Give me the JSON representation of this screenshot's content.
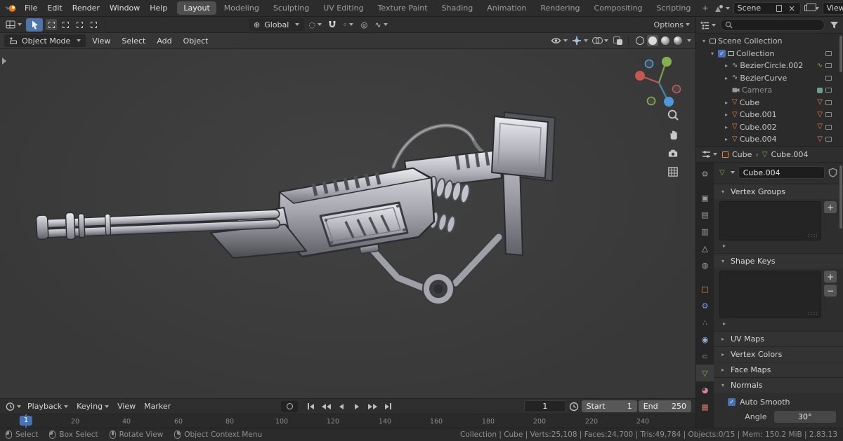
{
  "colors": {
    "accent_blue": "#4772b3",
    "mesh_orange": "#e8883d",
    "data_green": "#6fb747",
    "header_bg": "#2e2e2e",
    "viewport_bg": "#3d3d3d"
  },
  "topbar": {
    "menus": [
      "File",
      "Edit",
      "Render",
      "Window",
      "Help"
    ],
    "workspaces": [
      "Layout",
      "Modeling",
      "Sculpting",
      "UV Editing",
      "Texture Paint",
      "Shading",
      "Animation",
      "Rendering",
      "Compositing",
      "Scripting"
    ],
    "active_workspace": "Layout",
    "add_workspace_label": "+",
    "scene_label": "Scene",
    "view_layer_label": "View Layer"
  },
  "tool_header": {
    "orientation": "Global",
    "options_label": "Options"
  },
  "viewport_header": {
    "mode": "Object Mode",
    "menus": [
      "View",
      "Select",
      "Add",
      "Object"
    ]
  },
  "outliner": {
    "rows": [
      {
        "name": "Scene Collection"
      },
      {
        "name": "Collection"
      },
      {
        "name": "BezierCircle.002"
      },
      {
        "name": "BezierCurve"
      },
      {
        "name": "Camera"
      },
      {
        "name": "Cube"
      },
      {
        "name": "Cube.001"
      },
      {
        "name": "Cube.002"
      },
      {
        "name": "Cube.004"
      }
    ]
  },
  "properties": {
    "breadcrumb": {
      "object": "Cube",
      "data": "Cube.004"
    },
    "name_field": "Cube.004",
    "panels": {
      "vertex_groups": "Vertex Groups",
      "shape_keys": "Shape Keys",
      "uv_maps": "UV Maps",
      "vertex_colors": "Vertex Colors",
      "face_maps": "Face Maps",
      "normals": "Normals"
    },
    "auto_smooth_label": "Auto Smooth",
    "angle_label": "Angle",
    "angle_value": "30°",
    "list_add": "+",
    "list_remove": "−",
    "tabs": [
      "tool",
      "render",
      "output",
      "view-layer",
      "scene",
      "world",
      "object",
      "modifiers",
      "particles",
      "physics",
      "constraints",
      "object-data",
      "material",
      "texture"
    ],
    "active_tab": "object-data"
  },
  "timeline": {
    "menus": [
      "Playback",
      "Keying",
      "View",
      "Marker"
    ],
    "current_frame": "1",
    "playhead_label": "1",
    "start_label": "Start",
    "start_value": "1",
    "end_label": "End",
    "end_value": "250",
    "ticks": [
      "20",
      "40",
      "60",
      "80",
      "100",
      "120",
      "140",
      "160",
      "180",
      "200",
      "220",
      "240"
    ]
  },
  "statusbar": {
    "items": [
      {
        "label": "Select"
      },
      {
        "label": "Box Select"
      },
      {
        "label": "Rotate View"
      },
      {
        "label": "Object Context Menu"
      }
    ],
    "info": "Collection | Cube | Verts:25,108 | Faces:24,700 | Tris:49,784 | Objects:0/15 | Mem: 150.2 MiB | 2.83.13"
  }
}
